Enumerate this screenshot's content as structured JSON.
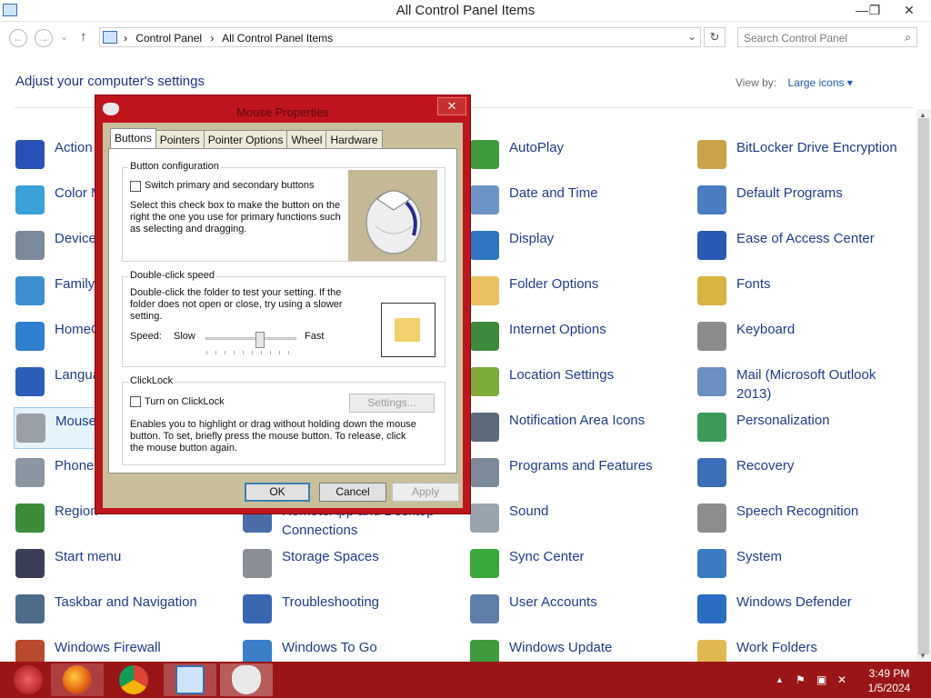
{
  "window": {
    "title": "All Control Panel Items",
    "min": "—",
    "max": "❐",
    "close": "✕"
  },
  "nav": {
    "back": "←",
    "forward": "→",
    "up": "↑",
    "dropdown": "⌄",
    "refresh": "↻"
  },
  "address": {
    "crumbs": [
      "Control Panel",
      "All Control Panel Items"
    ],
    "sep": "›"
  },
  "search": {
    "placeholder": "Search Control Panel",
    "icon": "⌕"
  },
  "main": {
    "heading": "Adjust your computer's settings",
    "view_by_label": "View by:",
    "view_by_value": "Large icons ▾"
  },
  "items": [
    {
      "label": "Action Center",
      "icon": "flag-icon",
      "color": "#2a4fb5"
    },
    {
      "label": "Color Management",
      "icon": "color-icon",
      "color": "#3aa0d8"
    },
    {
      "label": "Device Manager",
      "icon": "device-icon",
      "color": "#7a8a9a"
    },
    {
      "label": "Family Safety",
      "icon": "family-icon",
      "color": "#3e8fd1"
    },
    {
      "label": "HomeGroup",
      "icon": "homegroup-icon",
      "color": "#2e7fd0"
    },
    {
      "label": "Language",
      "icon": "language-icon",
      "color": "#2b5eb8"
    },
    {
      "label": "Mouse",
      "icon": "mouse-icon",
      "color": "#9aa0a6"
    },
    {
      "label": "Phone and Modem",
      "icon": "phone-icon",
      "color": "#8a96a2"
    },
    {
      "label": "Region",
      "icon": "region-icon",
      "color": "#3c8c3c"
    },
    {
      "label": "Start menu",
      "icon": "start-icon",
      "color": "#3b3f56"
    },
    {
      "label": "Taskbar and Navigation",
      "icon": "taskbar-icon",
      "color": "#4f6b8a"
    },
    {
      "label": "Windows Firewall",
      "icon": "firewall-icon",
      "color": "#b84a2e"
    },
    {
      "label": "RemoteApp and Desktop Connections",
      "icon": "remoteapp-icon",
      "color": "#4a6da8"
    },
    {
      "label": "Storage Spaces",
      "icon": "storage-icon",
      "color": "#8a8f96"
    },
    {
      "label": "Troubleshooting",
      "icon": "troubleshoot-icon",
      "color": "#3a66b0"
    },
    {
      "label": "Windows To Go",
      "icon": "windowstogo-icon",
      "color": "#3a7fc8"
    },
    {
      "label": "AutoPlay",
      "icon": "autoplay-icon",
      "color": "#3c9b3c"
    },
    {
      "label": "Date and Time",
      "icon": "clock-icon",
      "color": "#6b95c5"
    },
    {
      "label": "Display",
      "icon": "display-icon",
      "color": "#2f77c2"
    },
    {
      "label": "Folder Options",
      "icon": "folder-icon",
      "color": "#e8c060"
    },
    {
      "label": "Internet Options",
      "icon": "internet-icon",
      "color": "#3d8a3d"
    },
    {
      "label": "Location Settings",
      "icon": "location-icon",
      "color": "#7cab3a"
    },
    {
      "label": "Notification Area Icons",
      "icon": "notification-icon",
      "color": "#5b6b7c"
    },
    {
      "label": "Programs and Features",
      "icon": "programs-icon",
      "color": "#7b8a98"
    },
    {
      "label": "Sound",
      "icon": "sound-icon",
      "color": "#9aa4ae"
    },
    {
      "label": "Sync Center",
      "icon": "sync-icon",
      "color": "#3aa83a"
    },
    {
      "label": "User Accounts",
      "icon": "users-icon",
      "color": "#5f7fa8"
    },
    {
      "label": "Windows Update",
      "icon": "update-icon",
      "color": "#3d9a3d"
    },
    {
      "label": "BitLocker Drive Encryption",
      "icon": "bitlocker-icon",
      "color": "#c9a24a"
    },
    {
      "label": "Default Programs",
      "icon": "default-programs-icon",
      "color": "#4b7cc2"
    },
    {
      "label": "Ease of Access Center",
      "icon": "ease-icon",
      "color": "#2a58b6"
    },
    {
      "label": "Fonts",
      "icon": "fonts-icon",
      "color": "#d8b440"
    },
    {
      "label": "Keyboard",
      "icon": "keyboard-icon",
      "color": "#8c8c8c"
    },
    {
      "label": "Mail (Microsoft Outlook 2013)",
      "icon": "mail-icon",
      "color": "#6a8fc0"
    },
    {
      "label": "Personalization",
      "icon": "personalization-icon",
      "color": "#3a9a58"
    },
    {
      "label": "Recovery",
      "icon": "recovery-icon",
      "color": "#3b6fb8"
    },
    {
      "label": "Speech Recognition",
      "icon": "microphone-icon",
      "color": "#8d8d8d"
    },
    {
      "label": "System",
      "icon": "system-icon",
      "color": "#3a7ac0"
    },
    {
      "label": "Windows Defender",
      "icon": "defender-icon",
      "color": "#2b6cc4"
    },
    {
      "label": "Work Folders",
      "icon": "workfolders-icon",
      "color": "#e0b850"
    }
  ],
  "dialog": {
    "title": "Mouse Properties",
    "close": "✕",
    "tabs": [
      "Buttons",
      "Pointers",
      "Pointer Options",
      "Wheel",
      "Hardware"
    ],
    "button_config": {
      "title": "Button configuration",
      "checkbox_label": "Switch primary and secondary buttons",
      "description": "Select this check box to make the button on the right the one you use for primary functions such as selecting and dragging."
    },
    "double_click": {
      "title": "Double-click speed",
      "description": "Double-click the folder to test your setting. If the folder does not open or close, try using a slower setting.",
      "speed_label": "Speed:",
      "slow": "Slow",
      "fast": "Fast",
      "speed_level": 0.6
    },
    "clicklock": {
      "title": "ClickLock",
      "checkbox_label": "Turn on ClickLock",
      "settings_button": "Settings...",
      "description": "Enables you to highlight or drag without holding down the mouse button. To set, briefly press the mouse button. To release, click the mouse button again."
    },
    "ok": "OK",
    "cancel": "Cancel",
    "apply": "Apply"
  },
  "taskbar": {
    "time": "3:49 PM",
    "date": "1/5/2024",
    "tray_icons": [
      "show-hidden-icon",
      "flag-icon",
      "network-icon",
      "volume-muted-icon"
    ],
    "tray_glyphs": [
      "▲",
      "⚑",
      "▣",
      "✕"
    ]
  }
}
